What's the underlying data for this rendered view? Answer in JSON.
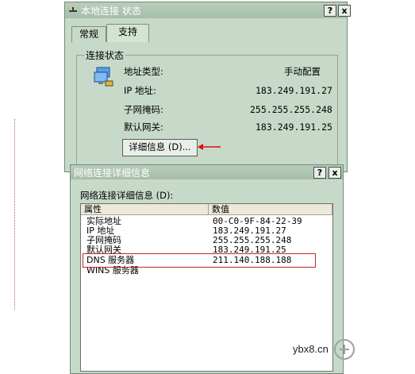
{
  "dialog1": {
    "title": "本地连接 状态",
    "help_btn": "?",
    "close_btn": "x",
    "tabs": [
      {
        "label": "常规"
      },
      {
        "label": "支持"
      }
    ],
    "group_title": "连接状态",
    "rows": [
      {
        "label": "地址类型:",
        "value": "手动配置"
      },
      {
        "label": "IP 地址:",
        "value": "183.249.191.27"
      },
      {
        "label": "子网掩码:",
        "value": "255.255.255.248"
      },
      {
        "label": "默认网关:",
        "value": "183.249.191.25"
      }
    ],
    "details_button": "详细信息 (D)..."
  },
  "dialog2": {
    "title": "网络连接详细信息",
    "help_btn": "?",
    "close_btn": "x",
    "list_label": "网络连接详细信息 (D):",
    "columns": [
      "属性",
      "数值"
    ],
    "rows": [
      {
        "prop": "实际地址",
        "value": "00-C0-9F-84-22-39"
      },
      {
        "prop": "IP 地址",
        "value": "183.249.191.27"
      },
      {
        "prop": "子网掩码",
        "value": "255.255.255.248"
      },
      {
        "prop": "默认网关",
        "value": "183.249.191.25"
      },
      {
        "prop": "DNS 服务器",
        "value": "211.140.188.188"
      },
      {
        "prop": "WINS 服务器",
        "value": ""
      }
    ]
  },
  "watermark": "ybx8.cn",
  "colors": {
    "dialog_bg": "#c7dac9",
    "highlight_box": "#cc2222",
    "arrow": "#dd1111"
  }
}
